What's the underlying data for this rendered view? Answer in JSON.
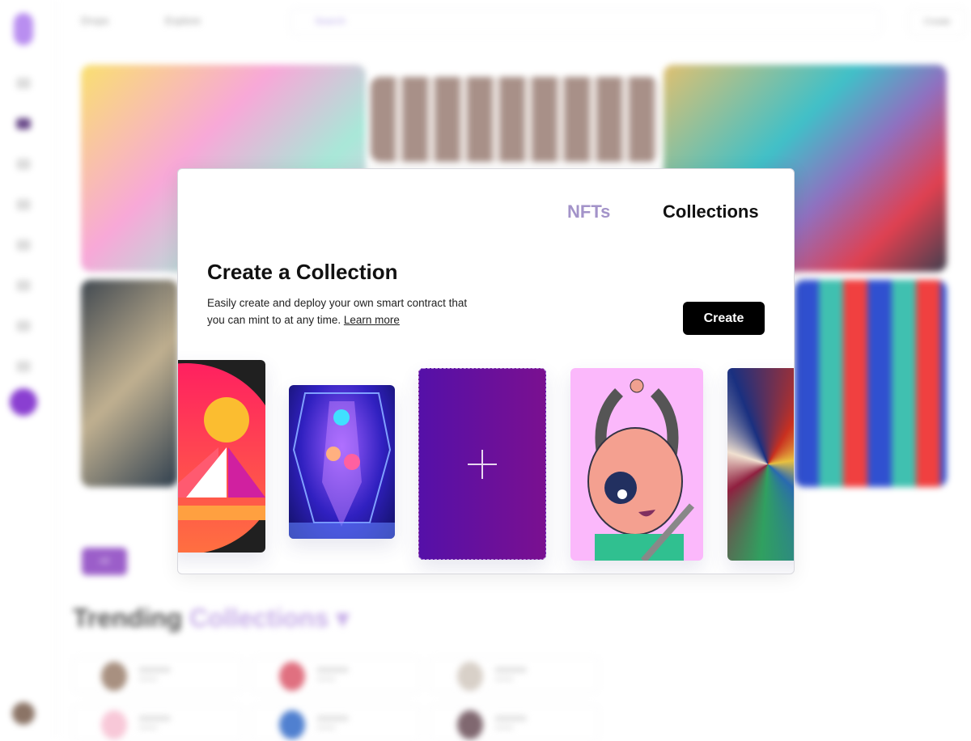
{
  "background": {
    "nav": {
      "drops": "Drops",
      "explore": "Explore",
      "search_placeholder": "Search",
      "create": "Create"
    },
    "filter_all": "All",
    "trending": {
      "prefix": "Trending",
      "accent": "Collections",
      "chevron": "▾"
    }
  },
  "modal": {
    "tabs": [
      {
        "label": "NFTs",
        "active": false
      },
      {
        "label": "Collections",
        "active": true
      }
    ],
    "title": "Create a Collection",
    "description": "Easily create and deploy your own smart contract that you can mint to at any time.",
    "learn_more": "Learn more",
    "create_button": "Create",
    "cards": [
      {
        "type": "image",
        "icon": "sailboat-art"
      },
      {
        "type": "image",
        "icon": "crystal-mask-art"
      },
      {
        "type": "add",
        "icon": "plus-icon"
      },
      {
        "type": "image",
        "icon": "robot-character-art"
      },
      {
        "type": "image",
        "icon": "abstract-paint-art"
      }
    ]
  },
  "colors": {
    "accent": "#8a3fd1",
    "tab_inactive": "#a393c9",
    "button": "#000000"
  }
}
